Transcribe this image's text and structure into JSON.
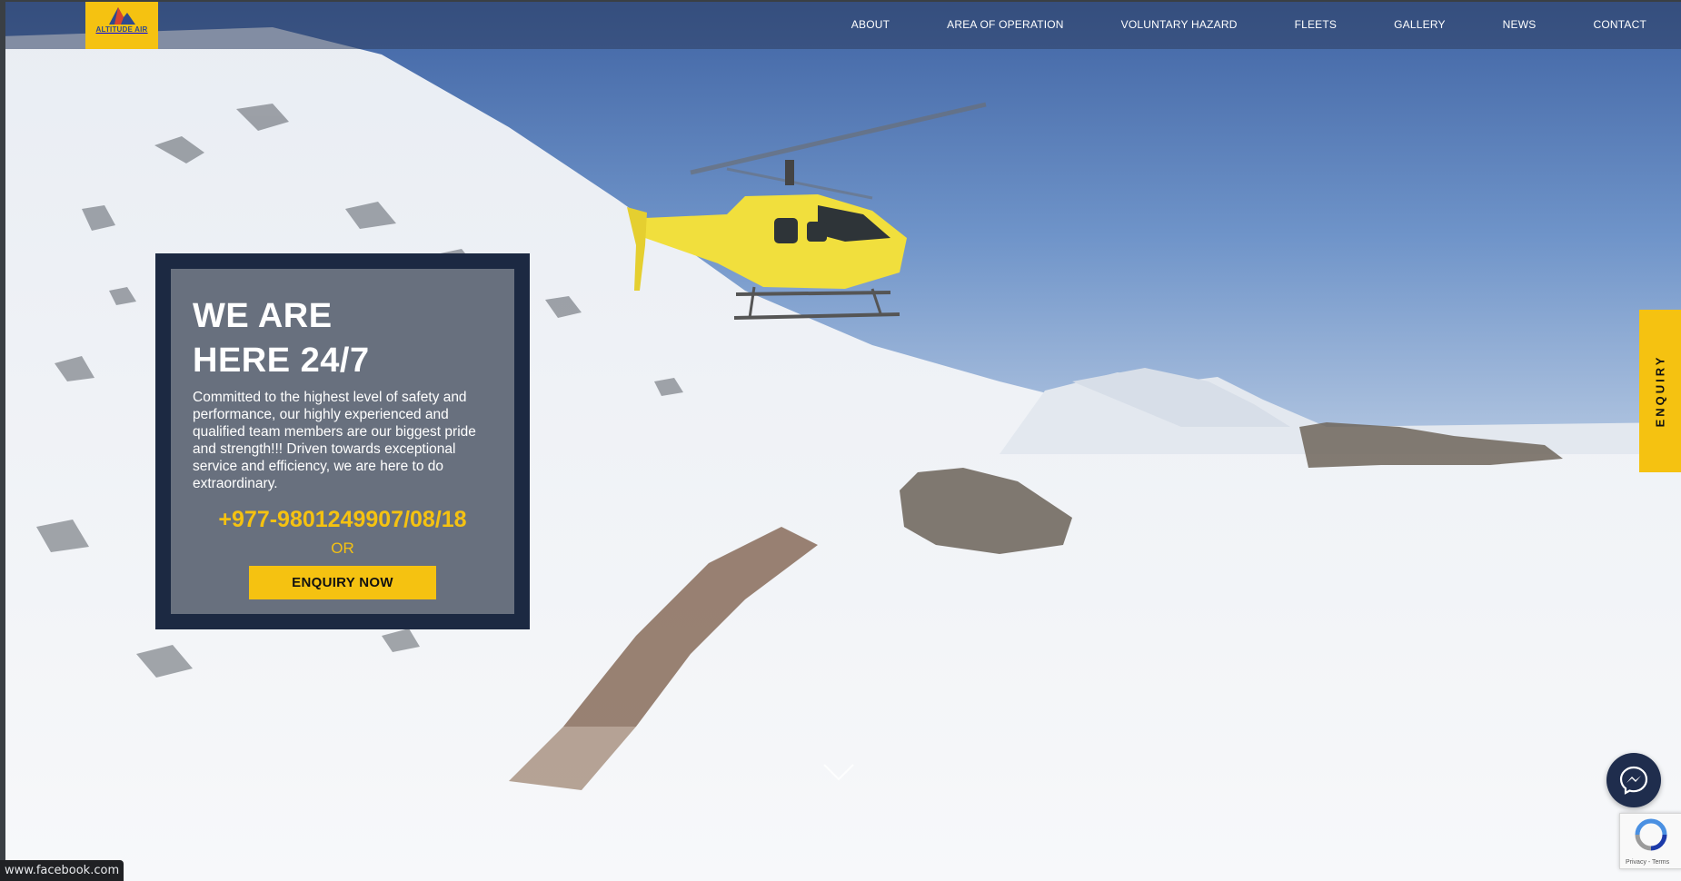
{
  "brand": {
    "name": "ALTITUDE AIR",
    "tagline": "",
    "colors": {
      "accent": "#f5c211",
      "navy": "#1c2942",
      "nav_text": "#ffffff"
    }
  },
  "nav": {
    "items": [
      {
        "label": "ABOUT"
      },
      {
        "label": "AREA OF OPERATION"
      },
      {
        "label": "VOLUNTARY HAZARD"
      },
      {
        "label": "FLEETS"
      },
      {
        "label": "GALLERY"
      },
      {
        "label": "NEWS"
      },
      {
        "label": "CONTACT"
      }
    ]
  },
  "hero": {
    "title_line1": "WE ARE",
    "title_line2": "HERE 24/7",
    "description": "Committed to the highest level of safety and performance, our highly experienced and qualified team members are our biggest pride and strength!!! Driven towards exceptional service and efficiency, we are here to do extraordinary.",
    "phone": "+977-9801249907/08/18",
    "or_text": "OR",
    "cta_label": "ENQUIRY NOW"
  },
  "side_tab": {
    "label": "ENQUIRY"
  },
  "widgets": {
    "messenger_icon": "messenger-icon",
    "recaptcha_text": "Privacy - Terms"
  },
  "status_bar": {
    "url": "www.facebook.com"
  }
}
